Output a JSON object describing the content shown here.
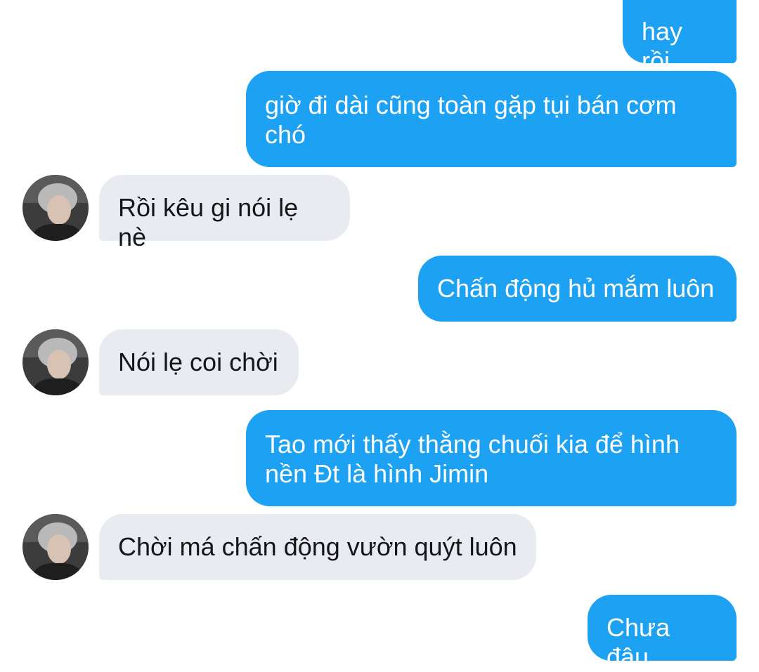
{
  "messages": [
    {
      "from": "me",
      "text": "hay rồi"
    },
    {
      "from": "me",
      "text": "giờ đi dài cũng toàn gặp tụi bán cơm chó"
    },
    {
      "from": "them",
      "text": "Rồi kêu gi nói lẹ nè"
    },
    {
      "from": "me",
      "text": "Chấn động hủ mắm luôn"
    },
    {
      "from": "them",
      "text": "Nói lẹ coi chời"
    },
    {
      "from": "me",
      "text": "Tao mới thấy thằng chuối kia để hình nền Đt là hình Jimin"
    },
    {
      "from": "them",
      "text": "Chời má chấn động vườn quýt luôn"
    },
    {
      "from": "me",
      "text": "Chưa đâu"
    }
  ],
  "colors": {
    "outgoing_bubble": "#1da1f2",
    "incoming_bubble": "#e8ecf0",
    "background": "#ffffff"
  },
  "icons": {
    "avatar": "contact-avatar-photo"
  }
}
